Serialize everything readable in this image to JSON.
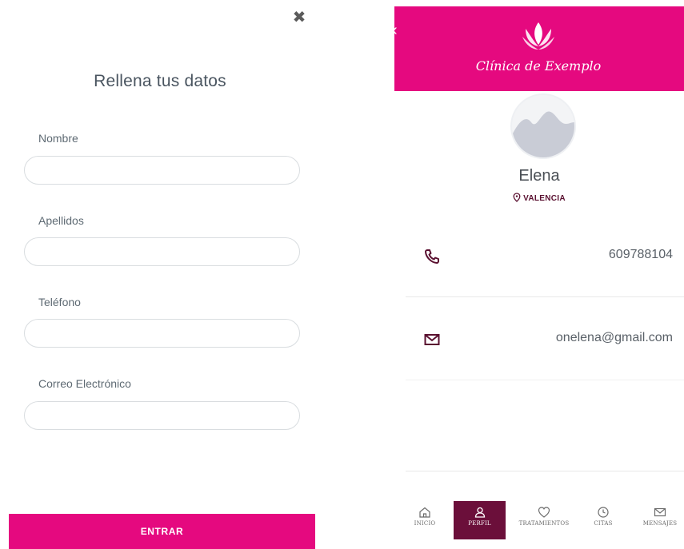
{
  "form": {
    "close_icon": "close-x-icon",
    "title": "Rellena tus datos",
    "fields": [
      {
        "label": "Nombre",
        "value": "",
        "placeholder": ""
      },
      {
        "label": "Apellidos",
        "value": "",
        "placeholder": ""
      },
      {
        "label": "Teléfono",
        "value": "",
        "placeholder": ""
      },
      {
        "label": "Correo Electrónico",
        "value": "",
        "placeholder": ""
      }
    ],
    "submit_label": "ENTRAR"
  },
  "profile": {
    "clinic_name": "Clínica de Exemplo",
    "name": "Elena",
    "location": "VALENCIA",
    "phone": "609788104",
    "email": "onelena@gmail.com"
  },
  "nav": {
    "items": [
      {
        "label": "INICIO",
        "icon": "home-icon",
        "active": false
      },
      {
        "label": "PERFIL",
        "icon": "user-icon",
        "active": true
      },
      {
        "label": "TRATAMIENTOS",
        "icon": "heart-icon",
        "active": false
      },
      {
        "label": "CITAS",
        "icon": "clock-icon",
        "active": false
      },
      {
        "label": "MENSAJES",
        "icon": "mail-icon",
        "active": false
      }
    ]
  },
  "colors": {
    "brand_pink": "#e5097f",
    "active_nav": "#6b0f3a",
    "icon_dark": "#5a1030"
  }
}
